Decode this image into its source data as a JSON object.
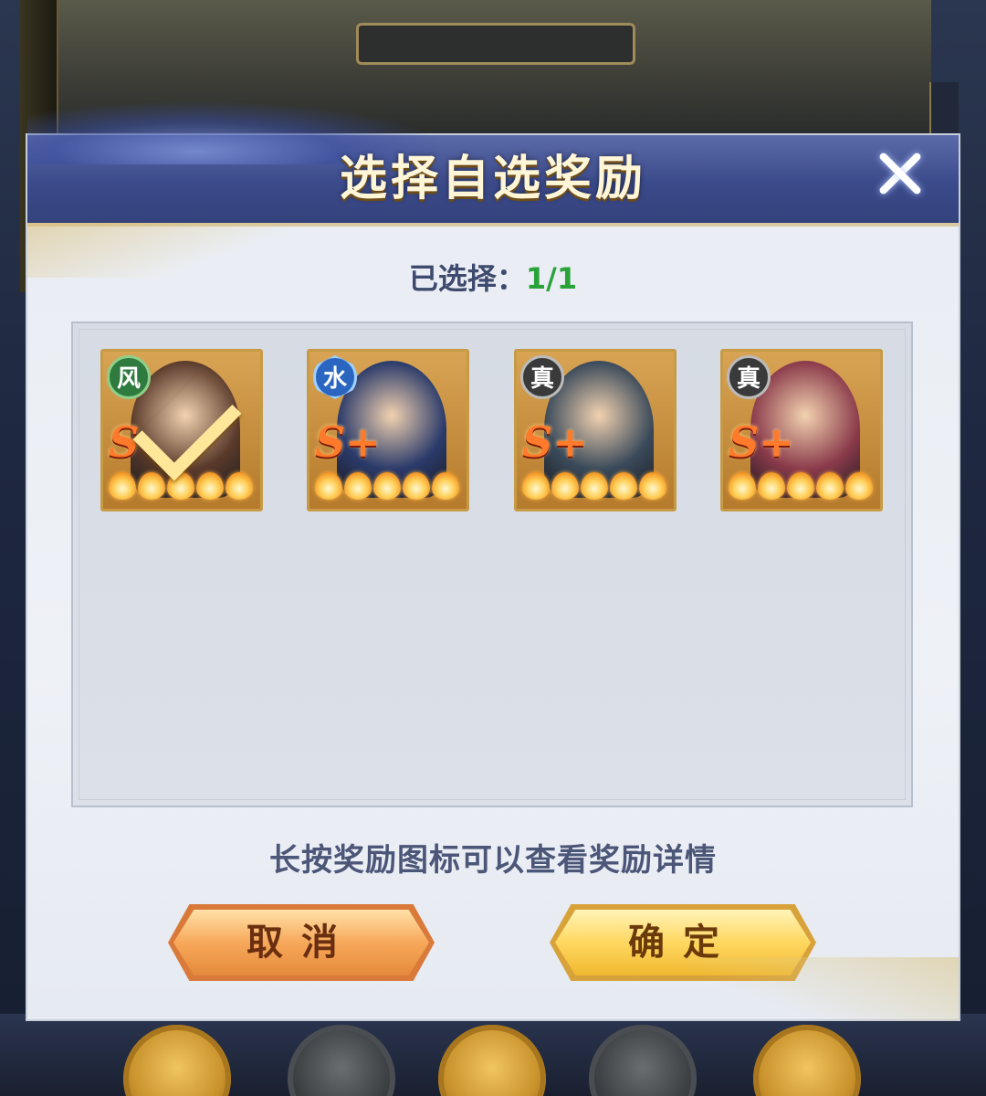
{
  "dialog": {
    "title": "选择自选奖励",
    "selected_label": "已选择：",
    "selected_count": "1/1",
    "hint": "长按奖励图标可以查看奖励详情",
    "cancel_label": "取消",
    "confirm_label": "确定"
  },
  "rewards": [
    {
      "element": "风",
      "grade": "S",
      "stars": 5,
      "selected": true,
      "portrait_color": "#5a3a2a"
    },
    {
      "element": "水",
      "grade": "S+",
      "stars": 5,
      "selected": false,
      "portrait_color": "#2a3a6a"
    },
    {
      "element": "真",
      "grade": "S+",
      "stars": 5,
      "selected": false,
      "portrait_color": "#3a4a5a"
    },
    {
      "element": "真",
      "grade": "S+",
      "stars": 5,
      "selected": false,
      "portrait_color": "#8a3a4a"
    }
  ],
  "colors": {
    "header": "#3b4a8a",
    "selected_count": "#2aa23a",
    "card_border": "#c79a46"
  }
}
